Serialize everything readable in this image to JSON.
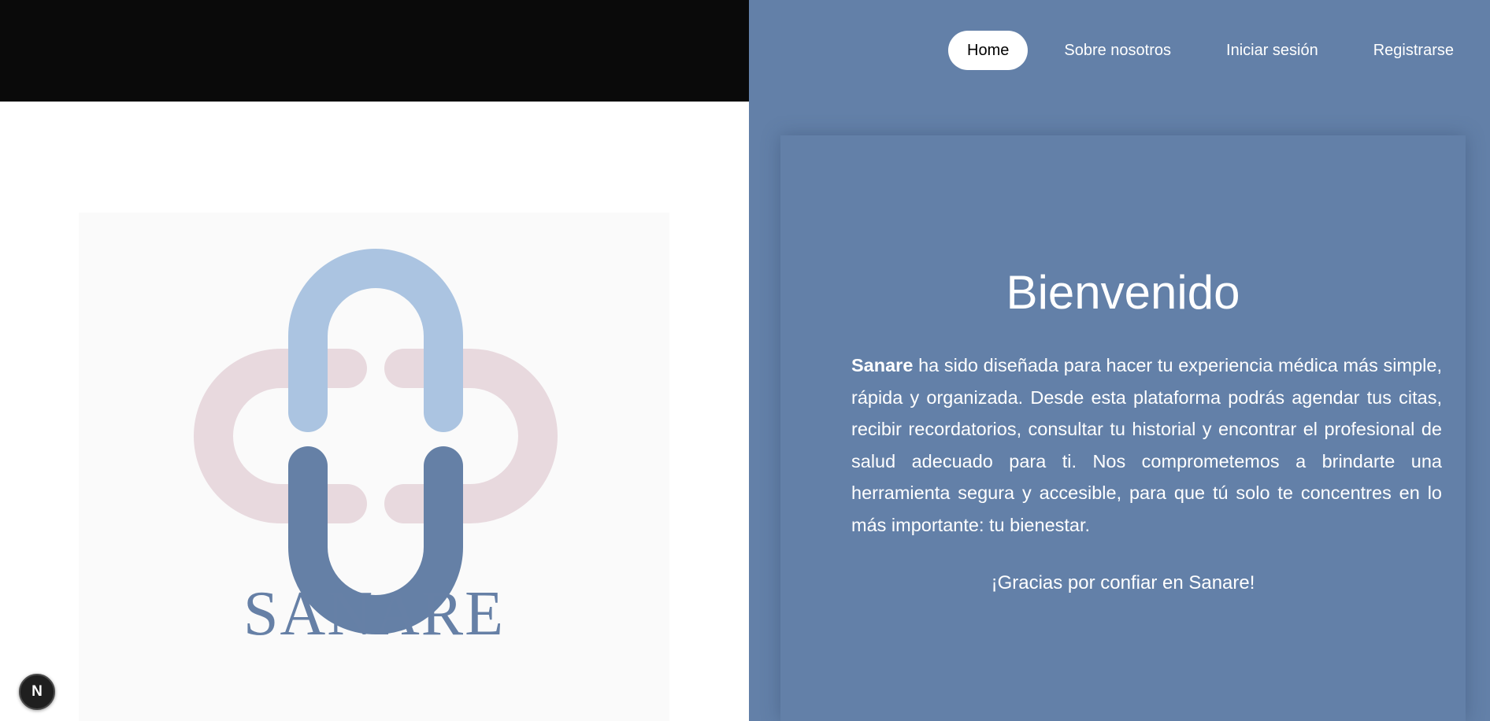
{
  "nav": {
    "items": [
      {
        "label": "Home",
        "active": true
      },
      {
        "label": "Sobre nosotros",
        "active": false
      },
      {
        "label": "Iniciar sesión",
        "active": false
      },
      {
        "label": "Registrarse",
        "active": false
      }
    ]
  },
  "logo": {
    "wordmark": "SANARE",
    "icon": "medical-cross-logo"
  },
  "welcome": {
    "title": "Bienvenido",
    "brand": "Sanare",
    "paragraph": " ha sido diseñada para hacer tu experiencia médica más simple, rápida y organizada. Desde esta plataforma podrás agendar tus citas, recibir recordatorios, consultar tu historial y encontrar el profesional de salud adecuado para ti. Nos comprometemos a brindarte una herramienta segura y accesible, para que tú solo te concentres en lo más importante: tu bienestar.",
    "thanks": "¡Gracias por confiar en Sanare!"
  },
  "dev_badge": {
    "label": "N",
    "icon": "nextjs-icon"
  },
  "colors": {
    "primary_blue": "#6380a8",
    "light_blue": "#a9c3e0",
    "light_pink": "#e8d9de",
    "dark_blue": "#6580a6",
    "topbar": "#0a0a0a"
  }
}
